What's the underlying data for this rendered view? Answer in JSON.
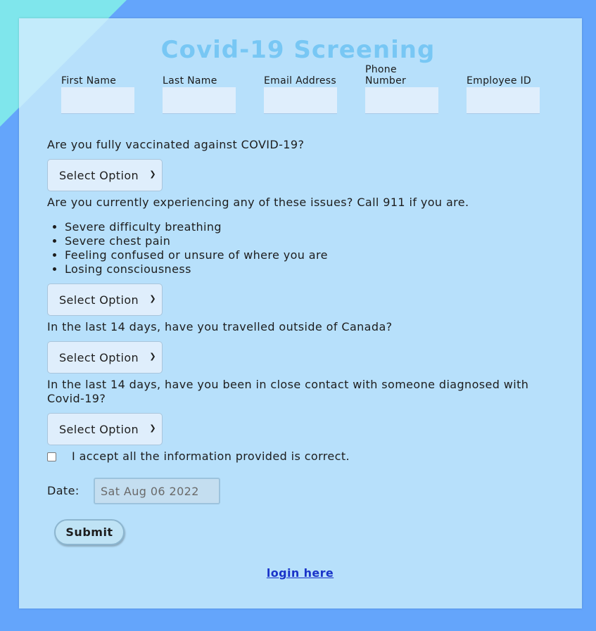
{
  "page": {
    "title": "Covid-19 Screening",
    "colors": {
      "background": "#64a5fb",
      "card": "#b7e0fb",
      "title": "#78c7f4",
      "link": "#1a34c9"
    }
  },
  "fields": [
    {
      "label": "First Name",
      "value": ""
    },
    {
      "label": "Last Name",
      "value": ""
    },
    {
      "label": "Email Address",
      "value": ""
    },
    {
      "label": "Phone Number",
      "value": ""
    },
    {
      "label": "Employee ID",
      "value": ""
    }
  ],
  "questions": {
    "vaccinated": {
      "text": "Are you fully vaccinated against COVID-19?",
      "selected": "Select Option"
    },
    "symptoms": {
      "text": "Are you currently experiencing any of these issues? Call 911 if you are.",
      "items": [
        "Severe difficulty breathing",
        "Severe chest pain",
        "Feeling confused or unsure of where you are",
        "Losing consciousness"
      ],
      "selected": "Select Option"
    },
    "travel": {
      "text": "In the last 14 days, have you travelled outside of Canada?",
      "selected": "Select Option"
    },
    "contact": {
      "text": "In the last 14 days, have you been in close contact with someone diagnosed with Covid-19?",
      "selected": "Select Option"
    }
  },
  "accept": {
    "text": "I accept all the information provided is correct.",
    "checked": false
  },
  "date": {
    "label": "Date:",
    "value": "Sat Aug 06 2022"
  },
  "submit": {
    "label": "Submit"
  },
  "login": {
    "label": "login here"
  }
}
